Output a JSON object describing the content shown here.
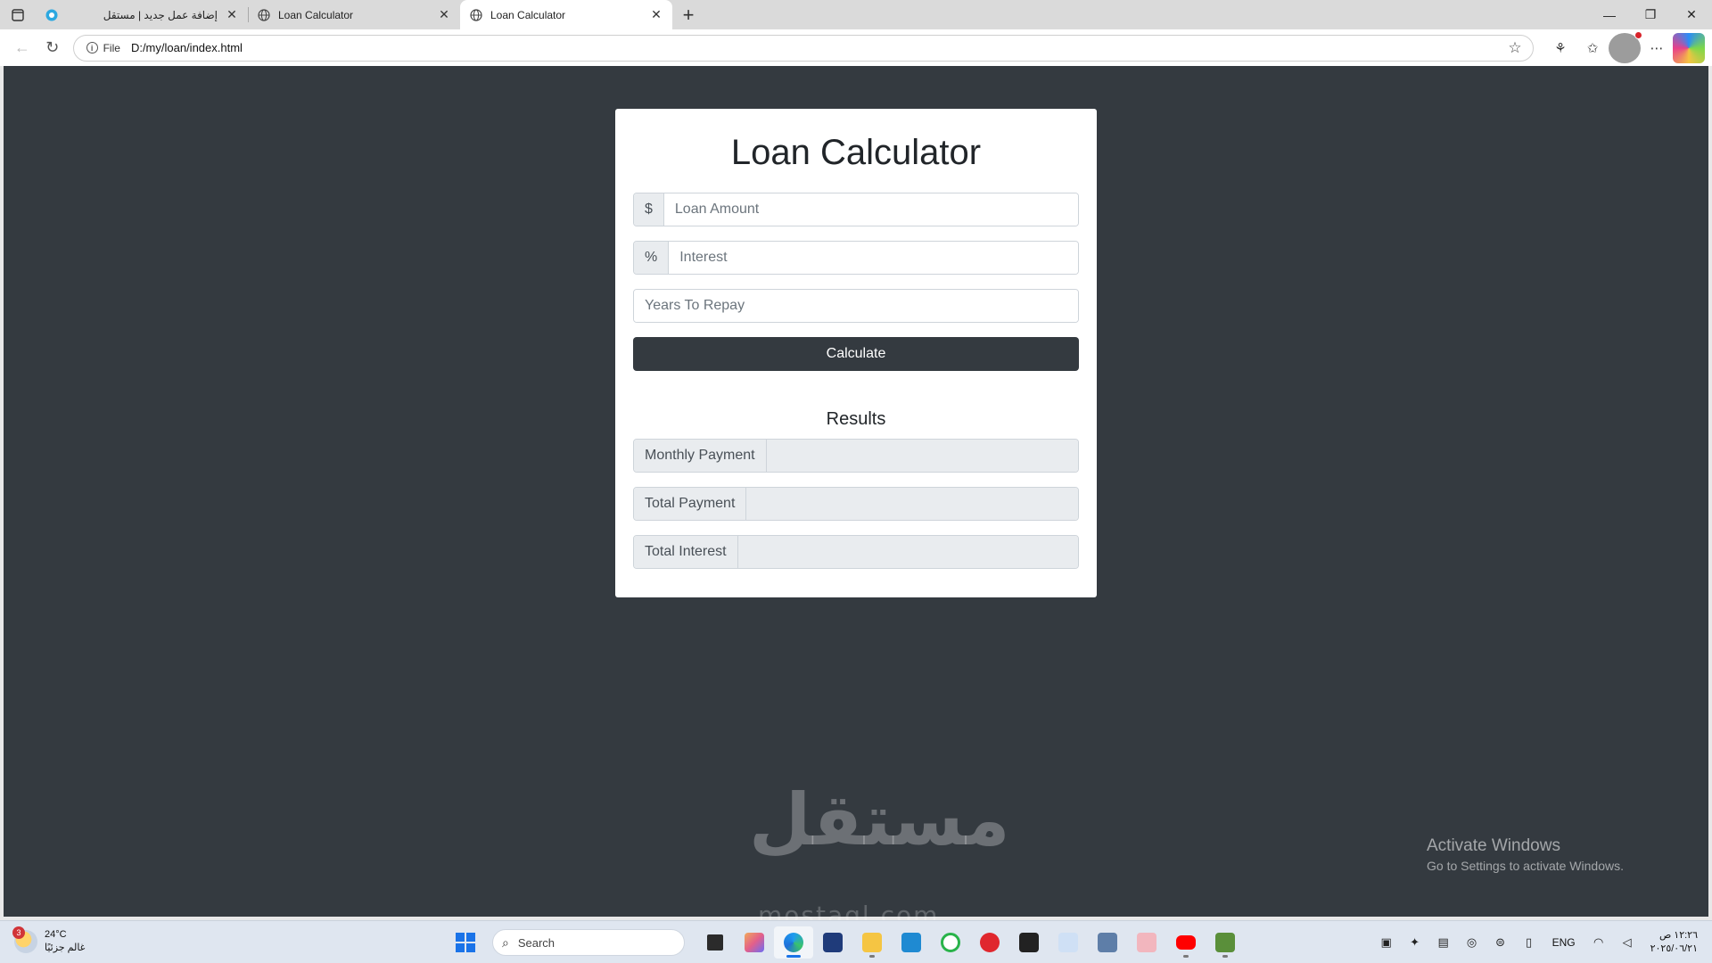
{
  "tabs": [
    {
      "title": "إضافة عمل جديد | مستقل",
      "active": false
    },
    {
      "title": "Loan Calculator",
      "active": false
    },
    {
      "title": "Loan Calculator",
      "active": true
    }
  ],
  "address_bar": {
    "scheme_label": "File",
    "url": "D:/my/loan/index.html"
  },
  "page": {
    "title": "Loan Calculator",
    "inputs": {
      "amount": {
        "prefix": "$",
        "placeholder": "Loan Amount",
        "value": ""
      },
      "interest": {
        "prefix": "%",
        "placeholder": "Interest",
        "value": ""
      },
      "years": {
        "placeholder": "Years To Repay",
        "value": ""
      }
    },
    "calculate_label": "Calculate",
    "results": {
      "title": "Results",
      "monthly_label": "Monthly Payment",
      "total_payment_label": "Total Payment",
      "total_interest_label": "Total Interest",
      "monthly_value": "",
      "total_payment_value": "",
      "total_interest_value": ""
    }
  },
  "overlay": {
    "watermark": "مستقل",
    "watermark_sub": "mostaql.com",
    "activate_title": "Activate Windows",
    "activate_sub": "Go to Settings to activate Windows."
  },
  "taskbar": {
    "weather_badge": "3",
    "weather_temp": "24°C",
    "weather_desc": "غالم جزئيًا",
    "search_placeholder": "Search",
    "language": "ENG",
    "time": "١٢:٢٦ ص",
    "date": "٢٠٢٥/٠٦/٢١"
  },
  "colors": {
    "page_background": "#343a40",
    "button": "#343a40",
    "card": "#ffffff",
    "addon": "#e9ecef"
  }
}
